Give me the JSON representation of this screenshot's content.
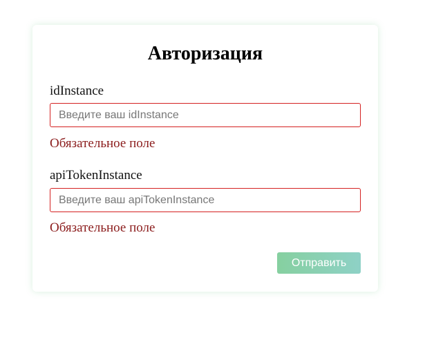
{
  "form": {
    "title": "Авторизация",
    "fields": [
      {
        "label": "idInstance",
        "placeholder": "Введите ваш idInstance",
        "value": "",
        "error": "Обязательное поле"
      },
      {
        "label": "apiTokenInstance",
        "placeholder": "Введите ваш apiTokenInstance",
        "value": "",
        "error": "Обязательное поле"
      }
    ],
    "submit_label": "Отправить"
  },
  "colors": {
    "error_border": "#d42020",
    "error_text": "#8b1c1c",
    "button_gradient_start": "#86d0a0",
    "button_gradient_end": "#8ed1c6"
  }
}
